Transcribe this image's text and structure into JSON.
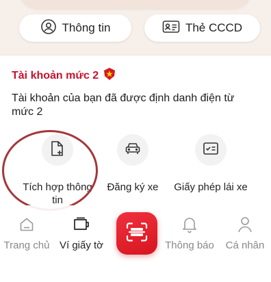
{
  "top_actions": {
    "info_label": "Thông tin",
    "card_label": "Thẻ CCCD"
  },
  "account": {
    "level_title": "Tài khoản mức 2",
    "description": "Tài khoản của bạn đã được định danh điện từ mức 2"
  },
  "shortcuts": [
    {
      "label": "Tích hợp thông tin",
      "icon": "file-add-icon"
    },
    {
      "label": "Đăng ký xe",
      "icon": "car-icon"
    },
    {
      "label": "Giấy phép lái xe",
      "icon": "license-icon"
    }
  ],
  "nav": {
    "items": [
      {
        "label": "Trang chủ",
        "icon": "home-icon"
      },
      {
        "label": "Ví giấy tờ",
        "icon": "wallet-icon"
      },
      {
        "label": "",
        "icon": "scan-icon"
      },
      {
        "label": "Thông báo",
        "icon": "bell-icon"
      },
      {
        "label": "Cá nhân",
        "icon": "user-icon"
      }
    ]
  },
  "colors": {
    "brand_red": "#c8102e",
    "scan_gradient": "#e5242f",
    "highlight_ring": "#a5363a"
  }
}
